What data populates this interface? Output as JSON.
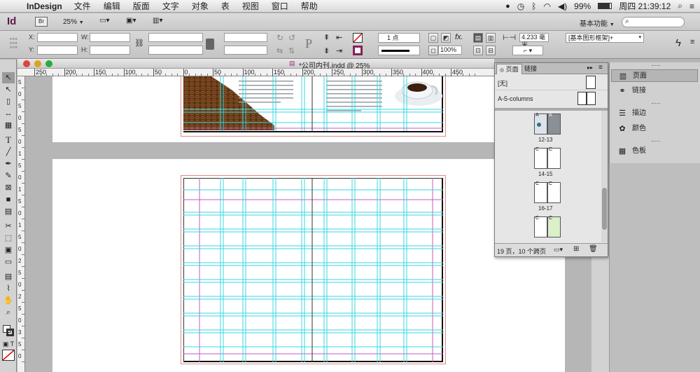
{
  "menubar": {
    "app_name": "InDesign",
    "items": [
      "文件",
      "编辑",
      "版面",
      "文字",
      "对象",
      "表",
      "视图",
      "窗口",
      "帮助"
    ],
    "battery": "99%",
    "clock": "周四 21:39:12"
  },
  "appbar": {
    "app_badge": "Id",
    "bridge_badge": "Br",
    "zoom": "25%",
    "workspace": "基本功能"
  },
  "control": {
    "x_label": "X:",
    "y_label": "Y:",
    "w_label": "W:",
    "h_label": "H:",
    "stroke_weight": "1 点",
    "opacity": "100%",
    "gutter": "4.233 毫米",
    "style": "[基本图形框架]+"
  },
  "document": {
    "title": "*公司内刊.indd @ 25%",
    "ruler_labels": [
      "250",
      "200",
      "150",
      "100",
      "50",
      "0",
      "50",
      "100",
      "150",
      "200",
      "250",
      "300",
      "350",
      "400",
      "450"
    ],
    "vruler_labels": [
      "5",
      "0",
      "5",
      "0",
      "5",
      "0",
      "1",
      "5",
      "0",
      "1",
      "5",
      "0",
      "1",
      "5",
      "0",
      "2",
      "5",
      "0",
      "2",
      "5",
      "0",
      "3",
      "5",
      "0"
    ]
  },
  "pages_panel": {
    "tab_pages": "页面",
    "tab_links": "链接",
    "master_none": "[无]",
    "master_a": "A-5-columns",
    "spreads": [
      {
        "label": "12-13",
        "left": "A",
        "right": "A"
      },
      {
        "label": "14-15",
        "left": "C",
        "right": "C"
      },
      {
        "label": "16-17",
        "left": "C",
        "right": "C"
      },
      {
        "label": "",
        "left": "C",
        "right": "C"
      }
    ],
    "footer": "19 页，10 个跨页"
  },
  "side_panel": {
    "items": [
      {
        "label": "页面",
        "icon": "pages-icon"
      },
      {
        "label": "链接",
        "icon": "links-icon"
      },
      {
        "label": "描边",
        "icon": "stroke-icon"
      },
      {
        "label": "颜色",
        "icon": "color-icon"
      },
      {
        "label": "色板",
        "icon": "swatches-icon"
      }
    ]
  },
  "colors": {
    "guide": "#3ad7e0",
    "margin": "#c05cc0",
    "bleed": "#e08a8a"
  }
}
